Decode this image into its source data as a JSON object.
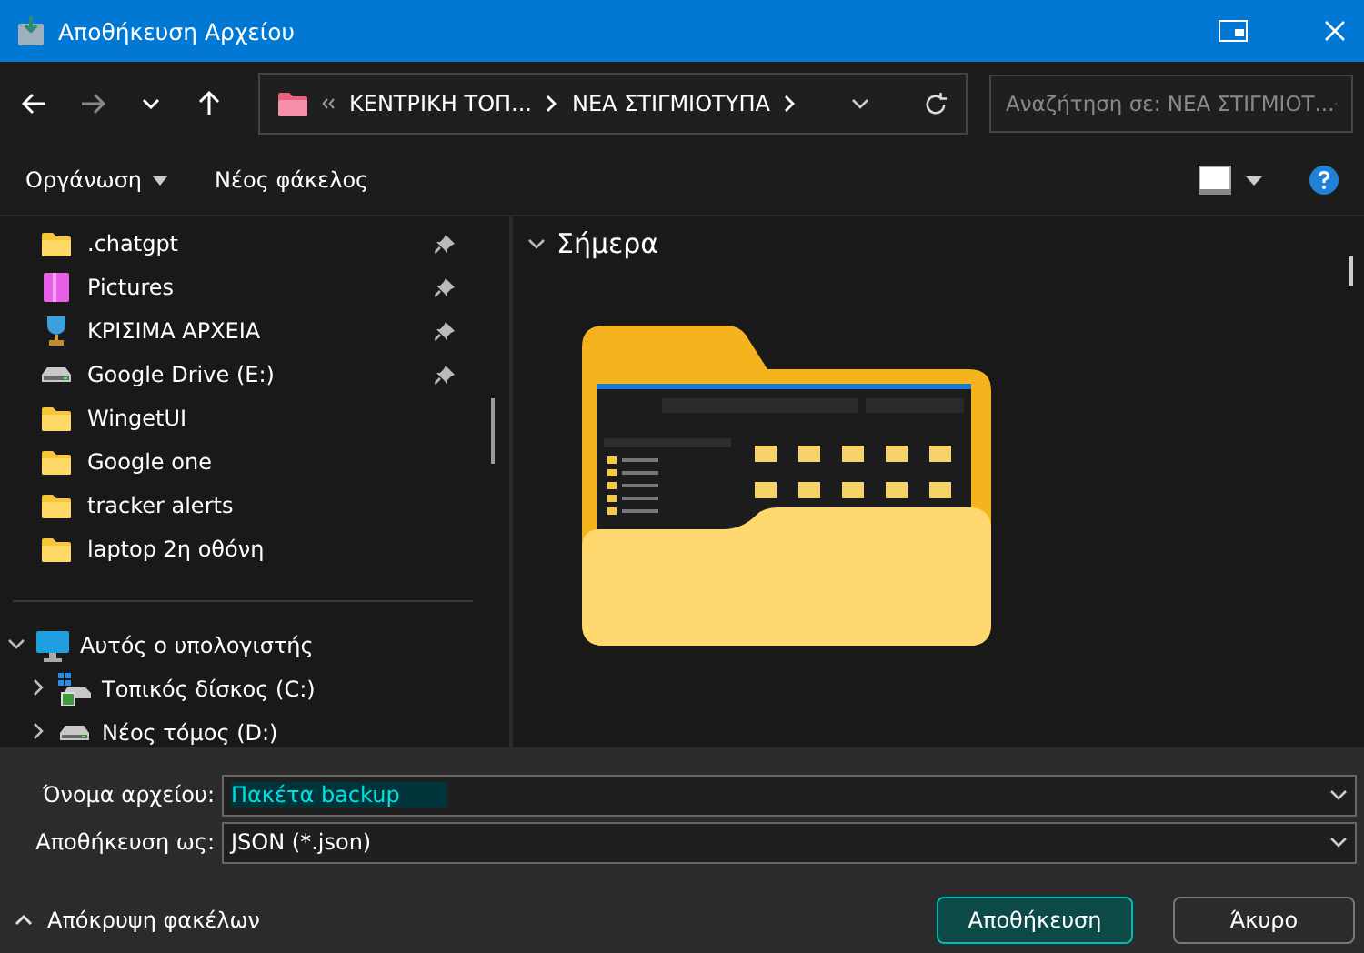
{
  "window": {
    "title": "Αποθήκευση Αρχείου"
  },
  "nav": {
    "path": [
      {
        "label": "ΚΕΝΤΡΙΚΗ ΤΟΠ..."
      },
      {
        "label": "ΝΕΑ ΣΤΙΓΜΙΟΤΥΠΑ"
      }
    ],
    "search": {
      "placeholder": "Αναζήτηση σε: ΝΕΑ ΣΤΙΓΜΙΟΤ..."
    }
  },
  "toolbar": {
    "items": [
      "Οργάνωση",
      "Νέος φάκελος"
    ]
  },
  "sidebar": {
    "quick_access": [
      {
        "label": ".chatgpt",
        "kind": "folder",
        "pinned": true
      },
      {
        "label": "Pictures",
        "kind": "pictures",
        "pinned": true
      },
      {
        "label": "ΚΡΙΣΙΜΑ ΑΡΧΕΙΑ",
        "kind": "trophy",
        "pinned": true
      },
      {
        "label": "Google Drive (E:)",
        "kind": "drive",
        "pinned": true
      },
      {
        "label": "WingetUI",
        "kind": "folder",
        "pinned": false
      },
      {
        "label": "Google one",
        "kind": "folder",
        "pinned": false
      },
      {
        "label": "tracker alerts",
        "kind": "folder",
        "pinned": false
      },
      {
        "label": "laptop 2η οθόνη",
        "kind": "folder",
        "pinned": false
      }
    ],
    "tree": [
      {
        "label": "Αυτός ο υπολογιστής",
        "kind": "pc",
        "expanded": true,
        "children": [
          {
            "label": "Τοπικός δίσκος (C:)",
            "kind": "system-drive",
            "expanded": false
          },
          {
            "label": "Νέος τόμος (D:)",
            "kind": "drive",
            "expanded": false
          }
        ]
      }
    ]
  },
  "content": {
    "group": {
      "label": "Σήμερα",
      "expanded": true
    }
  },
  "form": {
    "fields": [
      {
        "label": "Όνομα αρχείου:",
        "value": "Πακέτα backup",
        "text_selected": true
      },
      {
        "label": "Αποθήκευση ως:",
        "value": "JSON (*.json)",
        "text_selected": false
      }
    ]
  },
  "footer": {
    "toggle": {
      "label": "Απόκρυψη φακέλων"
    },
    "buttons": [
      {
        "label": "Αποθήκευση",
        "primary": true
      },
      {
        "label": "Άκυρο",
        "primary": false
      }
    ]
  }
}
